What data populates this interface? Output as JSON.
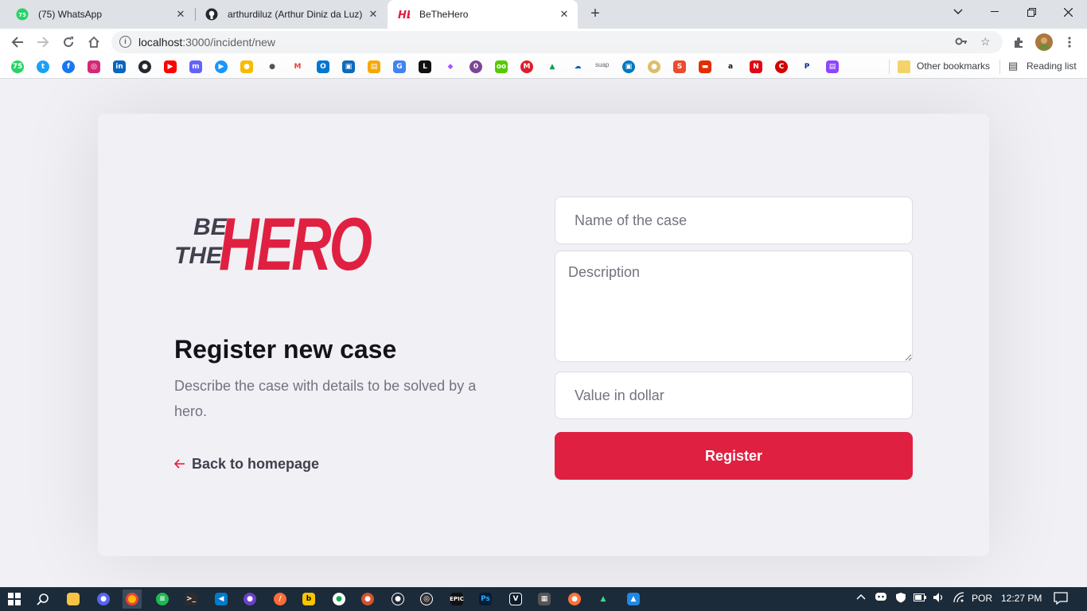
{
  "browser": {
    "tabs": [
      {
        "title": "(75) WhatsApp",
        "badge": "75",
        "active": false
      },
      {
        "title": "arthurdiluz (Arthur Diniz da Luz)",
        "active": false
      },
      {
        "title": "BeTheHero",
        "active": true
      }
    ],
    "new_tab": "+",
    "url_host": "localhost",
    "url_rest": ":3000/incident/new",
    "bookmarks": {
      "items": [
        "whatsapp",
        "twitter",
        "facebook",
        "instagram",
        "linkedin",
        "github",
        "youtube",
        "mastodon",
        "prime-video",
        "keep",
        "apple",
        "gmail",
        "outlook",
        "teams",
        "classroom",
        "translate",
        "notion",
        "figma",
        "onion",
        "duolingo",
        "meet",
        "drive",
        "onedrive",
        "suap",
        "trello",
        "edge",
        "shopee",
        "aliexpress",
        "amazon",
        "netflix",
        "brand-c",
        "paypal",
        "twitch"
      ],
      "suap_label": "suap",
      "other_bookmarks": "Other bookmarks",
      "reading_list": "Reading list"
    }
  },
  "page": {
    "logo_top": "BE",
    "logo_mid": "THE",
    "logo_main": "HERO",
    "heading": "Register new case",
    "description": "Describe the case with details to be solved by a hero.",
    "back_link": "Back to homepage",
    "form": {
      "name_placeholder": "Name of the case",
      "description_placeholder": "Description",
      "value_placeholder": "Value in dollar",
      "submit_label": "Register"
    },
    "colors": {
      "accent": "#e02041",
      "background": "#f0f0f5",
      "heading": "#13131a",
      "muted": "#737380"
    }
  },
  "taskbar": {
    "language": "POR",
    "time": "12:27 PM"
  }
}
